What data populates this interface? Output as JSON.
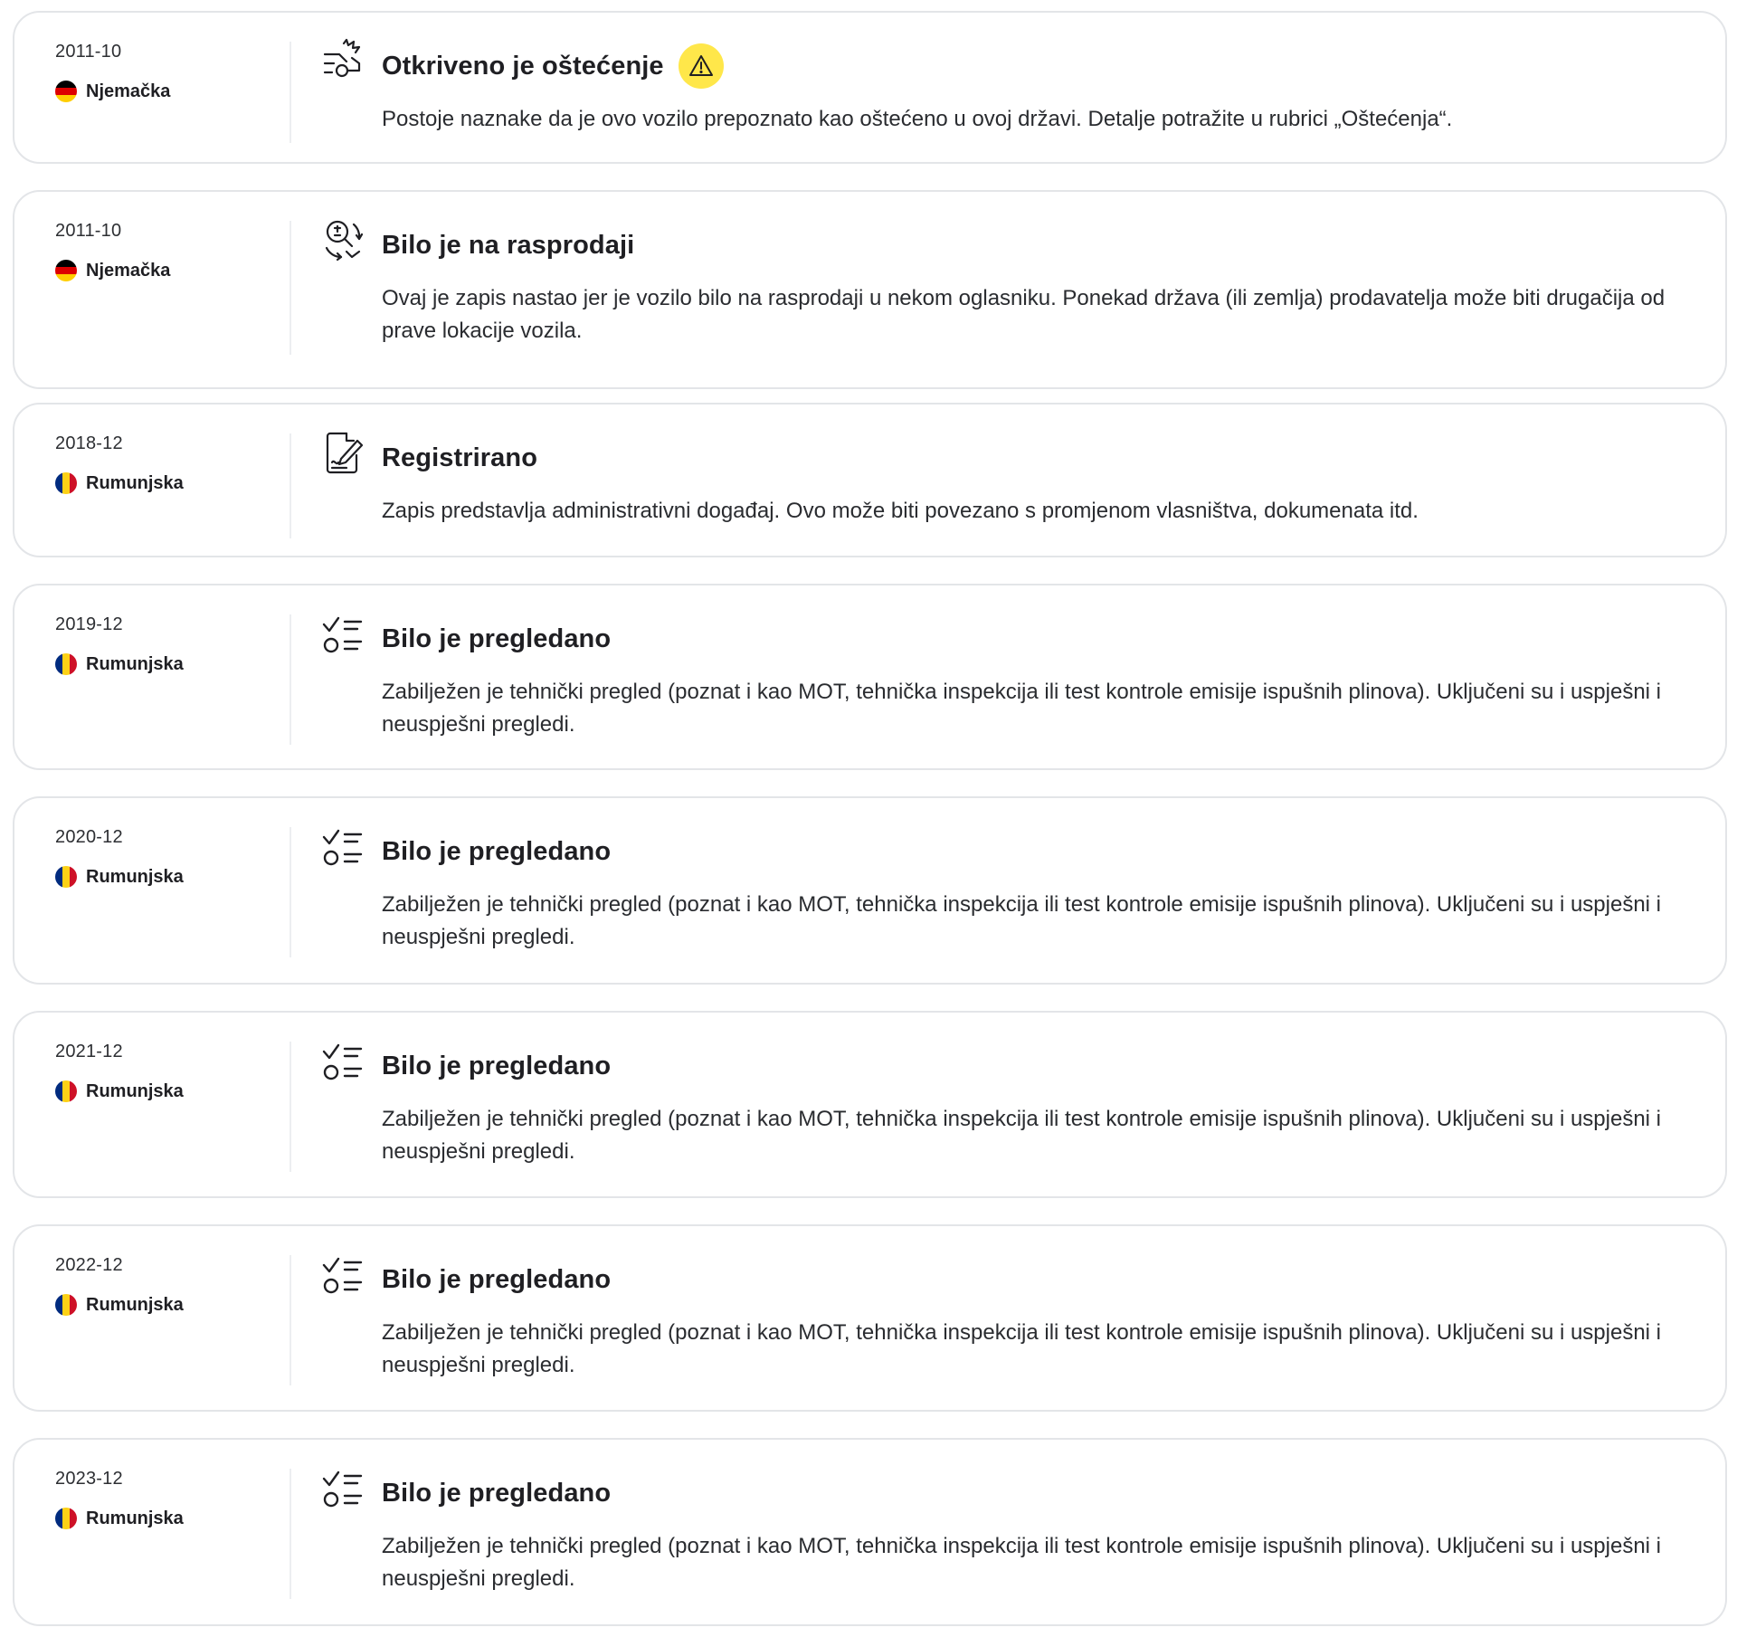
{
  "events": [
    {
      "date": "2011-10",
      "country": "Njemačka",
      "flag": "germany-flag",
      "icon": "damage-crash-icon",
      "title": "Otkriveno je oštećenje",
      "warning_icon": "warning-triangle-icon",
      "description": "Postoje naznake da je ovo vozilo prepoznato kao oštećeno u ovoj državi. Detalje potražite u rubrici „Oštećenja“."
    },
    {
      "date": "2011-10",
      "country": "Njemačka",
      "flag": "germany-flag",
      "icon": "sale-search-icon",
      "title": "Bilo je na rasprodaji",
      "description": "Ovaj je zapis nastao jer je vozilo bilo na rasprodaji u nekom oglasniku. Ponekad država (ili zemlja) prodavatelja može biti drugačija od prave lokacije vozila."
    },
    {
      "date": "2018-12",
      "country": "Rumunjska",
      "flag": "romania-flag",
      "icon": "registration-document-icon",
      "title": "Registrirano",
      "description": "Zapis predstavlja administrativni događaj. Ovo može biti povezano s promjenom vlasništva, dokumenata itd."
    },
    {
      "date": "2019-12",
      "country": "Rumunjska",
      "flag": "romania-flag",
      "icon": "inspection-checklist-icon",
      "title": "Bilo je pregledano",
      "description": "Zabilježen je tehnički pregled (poznat i kao MOT, tehnička inspekcija ili test kontrole emisije ispušnih plinova). Uključeni su i uspješni i neuspješni pregledi."
    },
    {
      "date": "2020-12",
      "country": "Rumunjska",
      "flag": "romania-flag",
      "icon": "inspection-checklist-icon",
      "title": "Bilo je pregledano",
      "description": "Zabilježen je tehnički pregled (poznat i kao MOT, tehnička inspekcija ili test kontrole emisije ispušnih plinova). Uključeni su i uspješni i neuspješni pregledi."
    },
    {
      "date": "2021-12",
      "country": "Rumunjska",
      "flag": "romania-flag",
      "icon": "inspection-checklist-icon",
      "title": "Bilo je pregledano",
      "description": "Zabilježen je tehnički pregled (poznat i kao MOT, tehnička inspekcija ili test kontrole emisije ispušnih plinova). Uključeni su i uspješni i neuspješni pregledi."
    },
    {
      "date": "2022-12",
      "country": "Rumunjska",
      "flag": "romania-flag",
      "icon": "inspection-checklist-icon",
      "title": "Bilo je pregledano",
      "description": "Zabilježen je tehnički pregled (poznat i kao MOT, tehnička inspekcija ili test kontrole emisije ispušnih plinova). Uključeni su i uspješni i neuspješni pregledi."
    },
    {
      "date": "2023-12",
      "country": "Rumunjska",
      "flag": "romania-flag",
      "icon": "inspection-checklist-icon",
      "title": "Bilo je pregledano",
      "description": "Zabilježen je tehnički pregled (poznat i kao MOT, tehnička inspekcija ili test kontrole emisije ispušnih plinova). Uključeni su i uspješni i neuspješni pregledi."
    }
  ],
  "colors": {
    "warning_badge": "#ffe74a",
    "card_border": "#e3e5e8",
    "germany": [
      "#000000",
      "#dd0000",
      "#ffce00"
    ],
    "romania": [
      "#002b7f",
      "#fcd116",
      "#ce1126"
    ]
  }
}
